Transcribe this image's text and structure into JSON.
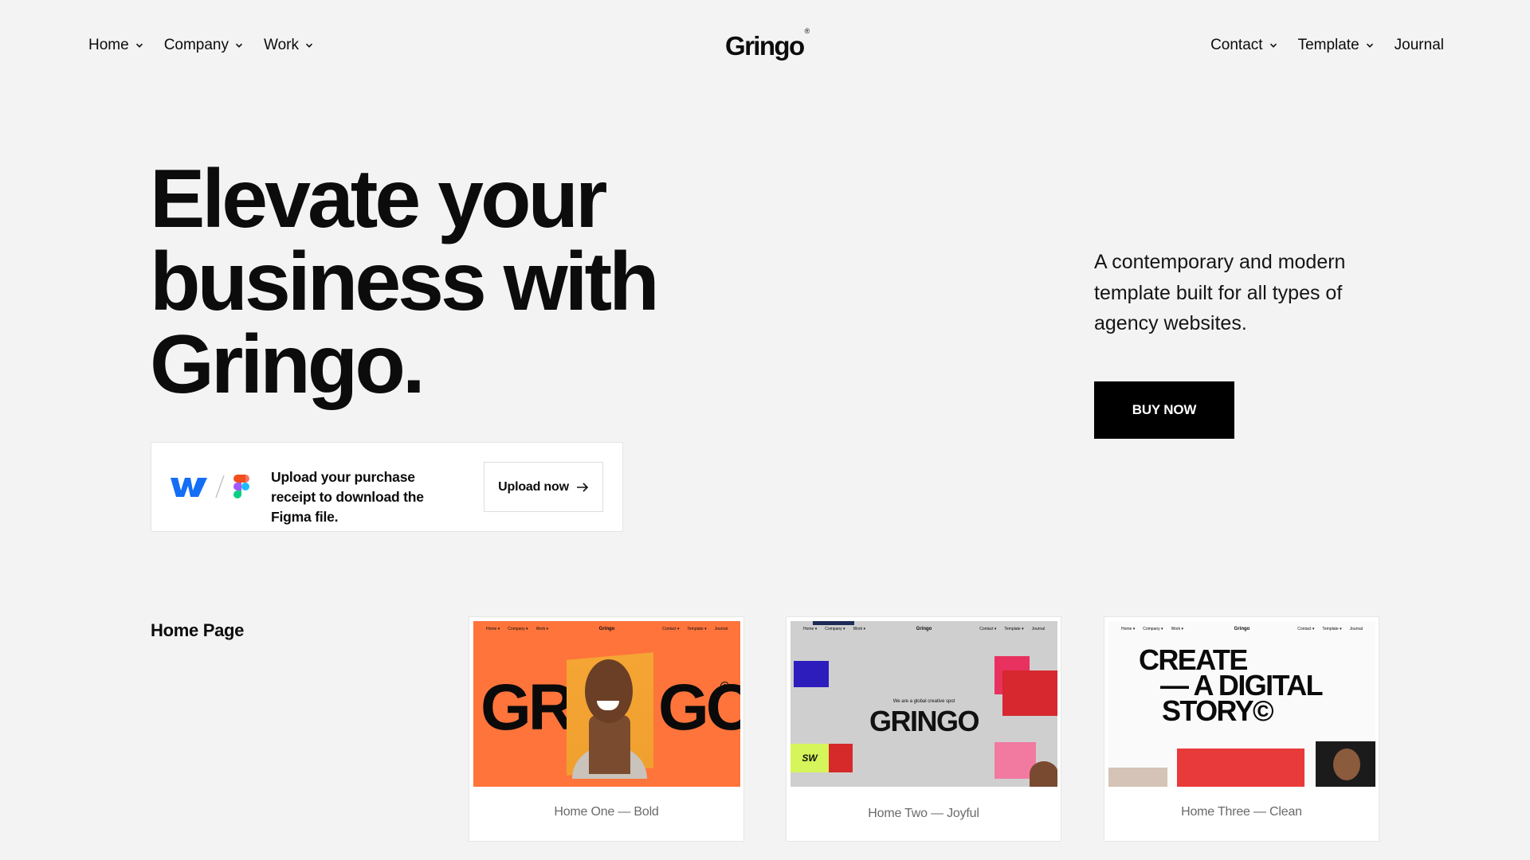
{
  "nav": {
    "left": [
      {
        "label": "Home",
        "dropdown": true
      },
      {
        "label": "Company",
        "dropdown": true
      },
      {
        "label": "Work",
        "dropdown": true
      }
    ],
    "logo": "Gringo",
    "logo_mark": "®",
    "right": [
      {
        "label": "Contact",
        "dropdown": true
      },
      {
        "label": "Template",
        "dropdown": true
      },
      {
        "label": "Journal",
        "dropdown": false
      }
    ]
  },
  "hero": {
    "title_lines": [
      "Elevate your",
      "business with",
      "Gringo."
    ],
    "description": "A contemporary and modern template built for all types of agency websites.",
    "cta_label": "BUY NOW"
  },
  "upload_card": {
    "icons": [
      "webflow-icon",
      "figma-icon"
    ],
    "separator": "/",
    "text": "Upload your purchase receipt to download the Figma file.",
    "button_label": "Upload now"
  },
  "home_section": {
    "label": "Home Page",
    "cards": [
      {
        "caption": "Home One — Bold",
        "thumb_text": "GR GO",
        "thumb_bg": "#ff743b"
      },
      {
        "caption": "Home Two — Joyful",
        "thumb_tagline": "We are a global creative spot",
        "thumb_text": "GRINGO",
        "thumb_badge": "SW",
        "thumb_bg": "#cfcfcf"
      },
      {
        "caption": "Home Three — Clean",
        "thumb_lines": [
          "CREATE",
          "— A DIGITAL",
          "STORY©"
        ],
        "thumb_bg": "#fafafa"
      }
    ],
    "mini_nav": {
      "left": [
        "Home ▾",
        "Company ▾",
        "Work ▾"
      ],
      "center": "Gringo",
      "right": [
        "Contact ▾",
        "Template ▾",
        "Journal"
      ]
    }
  },
  "colors": {
    "page_bg": "#f3f3f3",
    "text": "#0c0c0c",
    "button_bg": "#000000",
    "card_bg": "#ffffff",
    "accent_orange": "#ff743b",
    "webflow_blue": "#146ef5"
  }
}
